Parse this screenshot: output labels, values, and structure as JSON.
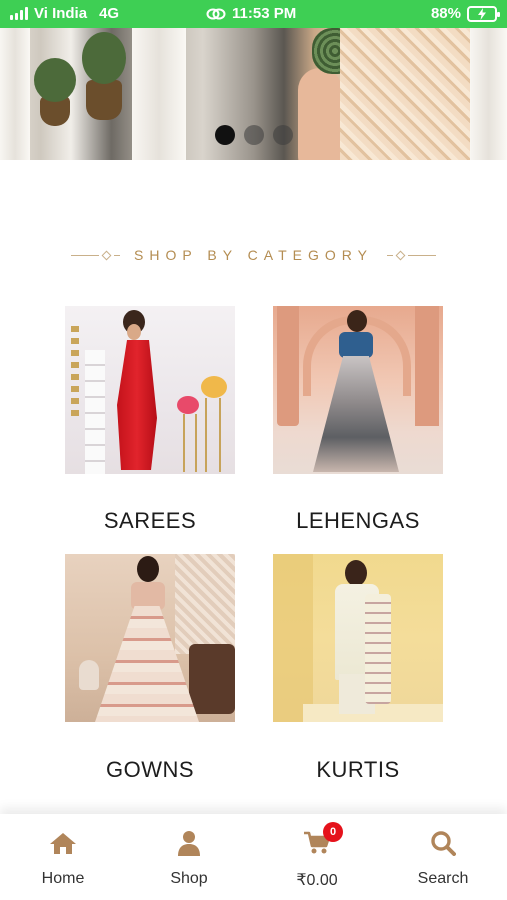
{
  "status_bar": {
    "carrier": "Vi India",
    "network": "4G",
    "time": "11:53 PM",
    "battery": "88%",
    "icons": [
      "signal-icon",
      "link-icon",
      "battery-charging-icon"
    ]
  },
  "hero": {
    "slide_count": 3,
    "active_slide": 1
  },
  "section": {
    "heading": "SHOP BY CATEGORY"
  },
  "categories": [
    {
      "label": "SAREES"
    },
    {
      "label": "LEHENGAS"
    },
    {
      "label": "GOWNS"
    },
    {
      "label": "KURTIS"
    }
  ],
  "bottom_nav": {
    "items": [
      {
        "label": "Home",
        "icon": "home-icon"
      },
      {
        "label": "Shop",
        "icon": "user-icon"
      },
      {
        "label": "₹0.00",
        "icon": "cart-icon",
        "badge": "0"
      },
      {
        "label": "Search",
        "icon": "search-icon"
      }
    ]
  },
  "colors": {
    "status_bar": "#3ecf54",
    "accent_gold": "#b48d52",
    "nav_icon": "#b0855a",
    "badge": "#e5121b"
  }
}
